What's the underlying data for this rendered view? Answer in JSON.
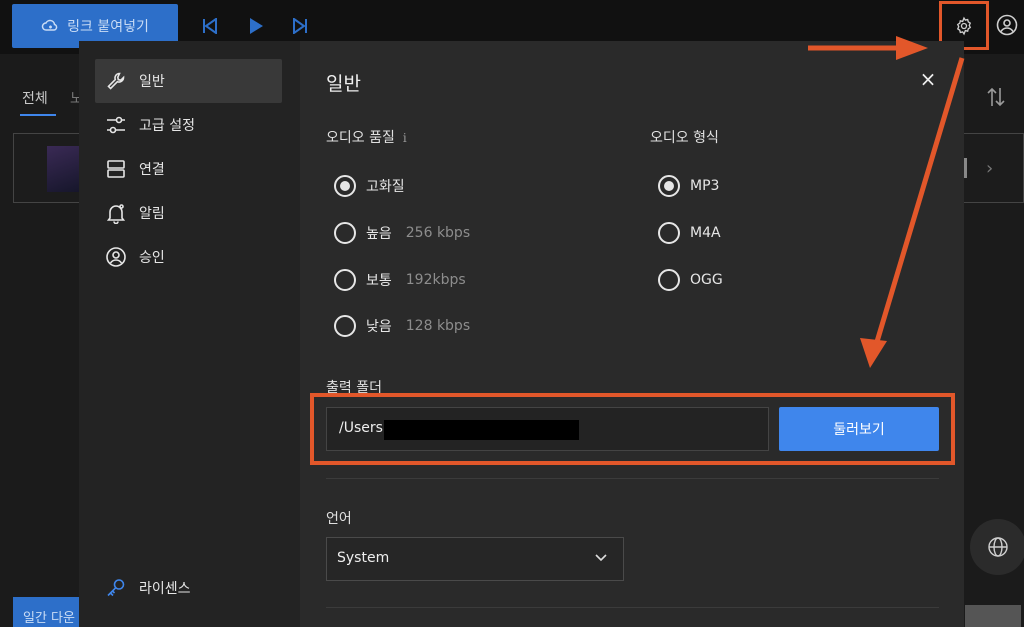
{
  "topbar": {
    "paste_button_label": "링크 붙여넣기"
  },
  "background": {
    "tab_all": "전체",
    "tab_second": "노",
    "bottom_button_label": "일간 다운"
  },
  "modal": {
    "sidebar": {
      "items": [
        {
          "label": "일반",
          "icon": "wrench-icon",
          "active": true
        },
        {
          "label": "고급 설정",
          "icon": "sliders-icon",
          "active": false
        },
        {
          "label": "연결",
          "icon": "server-icon",
          "active": false
        },
        {
          "label": "알림",
          "icon": "bell-icon",
          "active": false
        },
        {
          "label": "승인",
          "icon": "user-circle-icon",
          "active": false
        }
      ],
      "license_label": "라이센스"
    },
    "title": "일반",
    "close_symbol": "×",
    "audio_quality": {
      "label": "오디오 품질",
      "info_symbol": "i",
      "options": [
        {
          "label": "고화질",
          "detail": "",
          "selected": true
        },
        {
          "label": "높음",
          "detail": "256 kbps",
          "selected": false
        },
        {
          "label": "보통",
          "detail": "192kbps",
          "selected": false
        },
        {
          "label": "낮음",
          "detail": "128 kbps",
          "selected": false
        }
      ]
    },
    "audio_format": {
      "label": "오디오 형식",
      "options": [
        {
          "label": "MP3",
          "selected": true
        },
        {
          "label": "M4A",
          "selected": false
        },
        {
          "label": "OGG",
          "selected": false
        }
      ]
    },
    "output_folder": {
      "label": "출력 폴더",
      "value": "/Users",
      "browse_label": "둘러보기"
    },
    "language": {
      "label": "언어",
      "selected": "System"
    }
  },
  "colors": {
    "accent": "#3f86ec",
    "annotation": "#e2572a"
  }
}
